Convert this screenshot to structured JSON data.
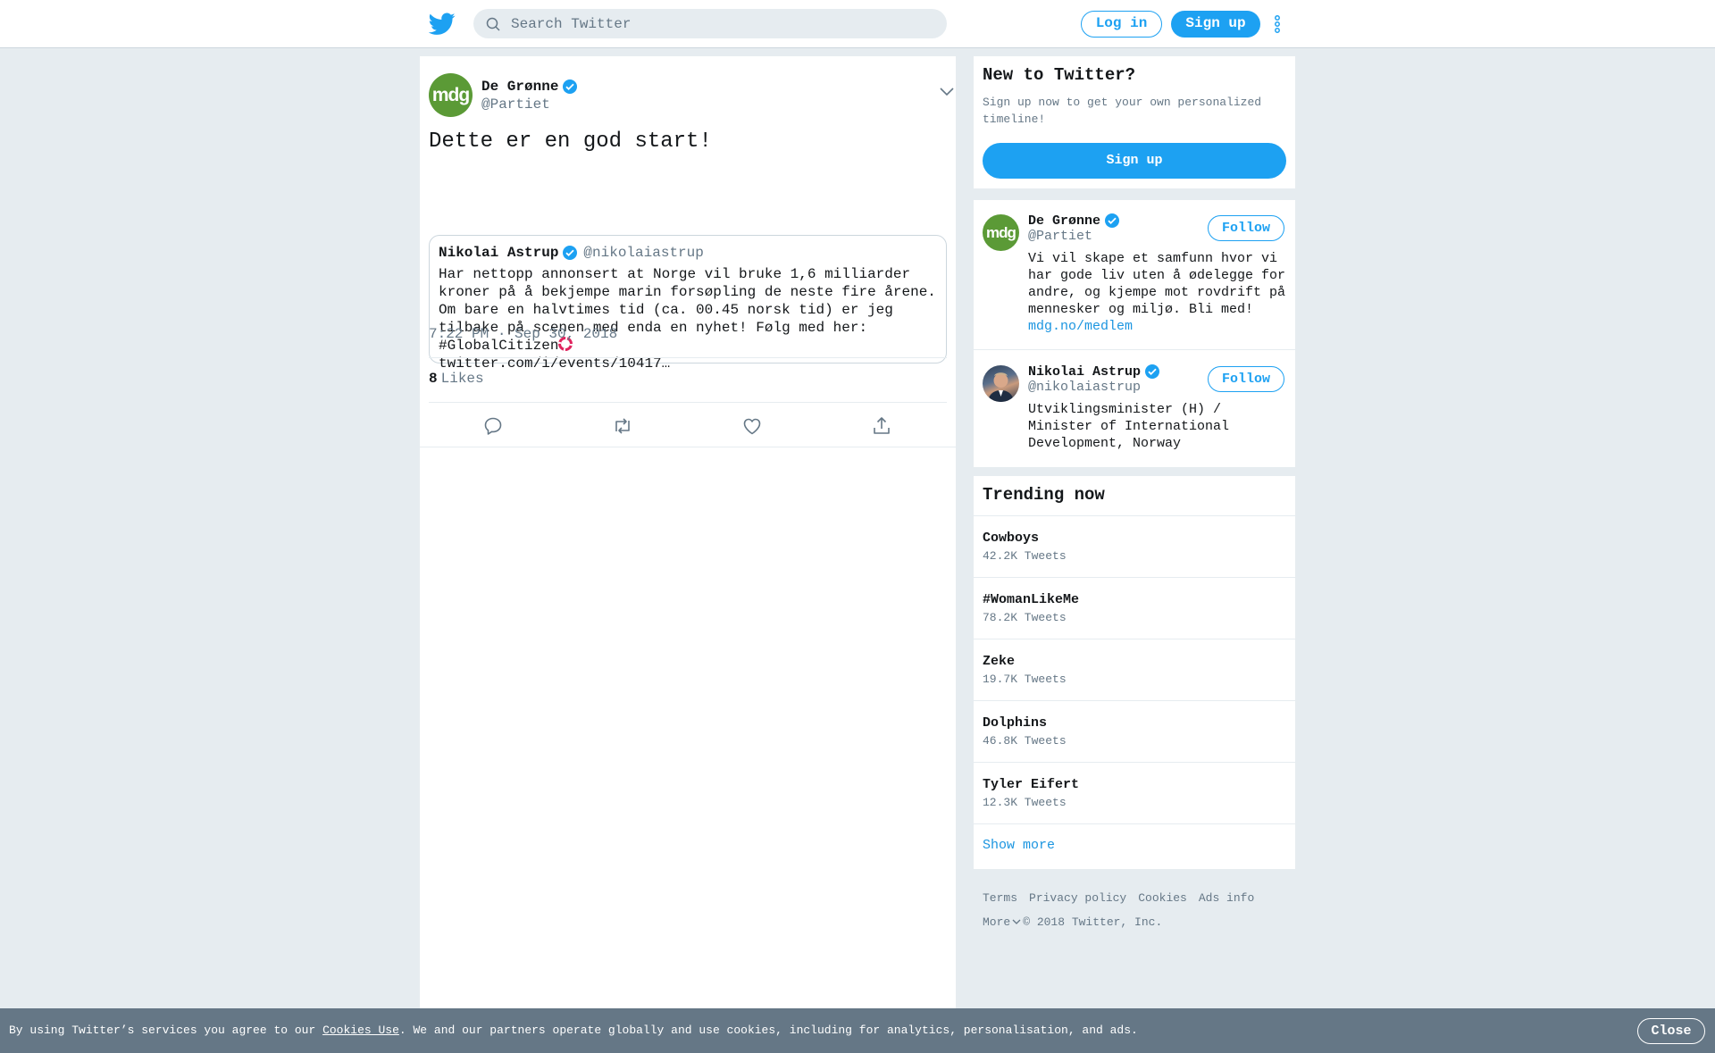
{
  "header": {
    "search_placeholder": "Search Twitter",
    "login_label": "Log in",
    "signup_label": "Sign up"
  },
  "tweet": {
    "author_name": "De Grønne",
    "author_handle": "@Partiet",
    "avatar_text": "mdg",
    "text": "Dette er en god start!",
    "quote": {
      "author_name": "Nikolai Astrup",
      "author_handle": "@nikolaiastrup",
      "text_before": "Har nettopp annonsert at Norge vil bruke 1,6 milliarder kroner på å bekjempe marin forsøpling de neste fire årene. Om bare en halvtimes tid (ca. 00.45 norsk tid) er jeg tilbake på scenen med enda en nyhet! Følg med her: #GlobalCitizen",
      "text_after": "twitter.com/i/events/10417…"
    },
    "timestamp": "7:22 PM · Sep 30, 2018",
    "likes_count": "8",
    "likes_label": "Likes"
  },
  "new_to_twitter": {
    "title": "New to Twitter?",
    "subtitle": "Sign up now to get your own personalized timeline!",
    "button": "Sign up"
  },
  "who_to_follow": [
    {
      "name": "De Grønne",
      "handle": "@Partiet",
      "avatar_text": "mdg",
      "bio": "Vi vil skape et samfunn hvor vi har gode liv uten å ødelegge for andre, og kjempe mot rovdrift på mennesker og miljø. Bli med!",
      "link": "mdg.no/medlem",
      "button": "Follow"
    },
    {
      "name": "Nikolai Astrup",
      "handle": "@nikolaiastrup",
      "bio": "Utviklingsminister (H) / Minister of International Development, Norway",
      "button": "Follow"
    }
  ],
  "trending": {
    "title": "Trending now",
    "items": [
      {
        "name": "Cowboys",
        "count": "42.2K Tweets"
      },
      {
        "name": "#WomanLikeMe",
        "count": "78.2K Tweets"
      },
      {
        "name": "Zeke",
        "count": "19.7K Tweets"
      },
      {
        "name": "Dolphins",
        "count": "46.8K Tweets"
      },
      {
        "name": "Tyler Eifert",
        "count": "12.3K Tweets"
      }
    ],
    "show_more": "Show more"
  },
  "footer": {
    "links": [
      "Terms",
      "Privacy policy",
      "Cookies",
      "Ads info"
    ],
    "more": "More",
    "copyright": "© 2018 Twitter, Inc."
  },
  "cookie_bar": {
    "text_before": "By using Twitter’s services you agree to our ",
    "link": "Cookies Use",
    "text_after": ". We and our partners operate globally and use cookies, including for analytics, personalisation, and ads.",
    "close": "Close"
  },
  "colors": {
    "brand_blue": "#1da1f2",
    "link_blue": "#1b95e0",
    "mdg_green": "#5b9a36",
    "background": "#e6ecf0",
    "cookie_bar": "#657786"
  }
}
